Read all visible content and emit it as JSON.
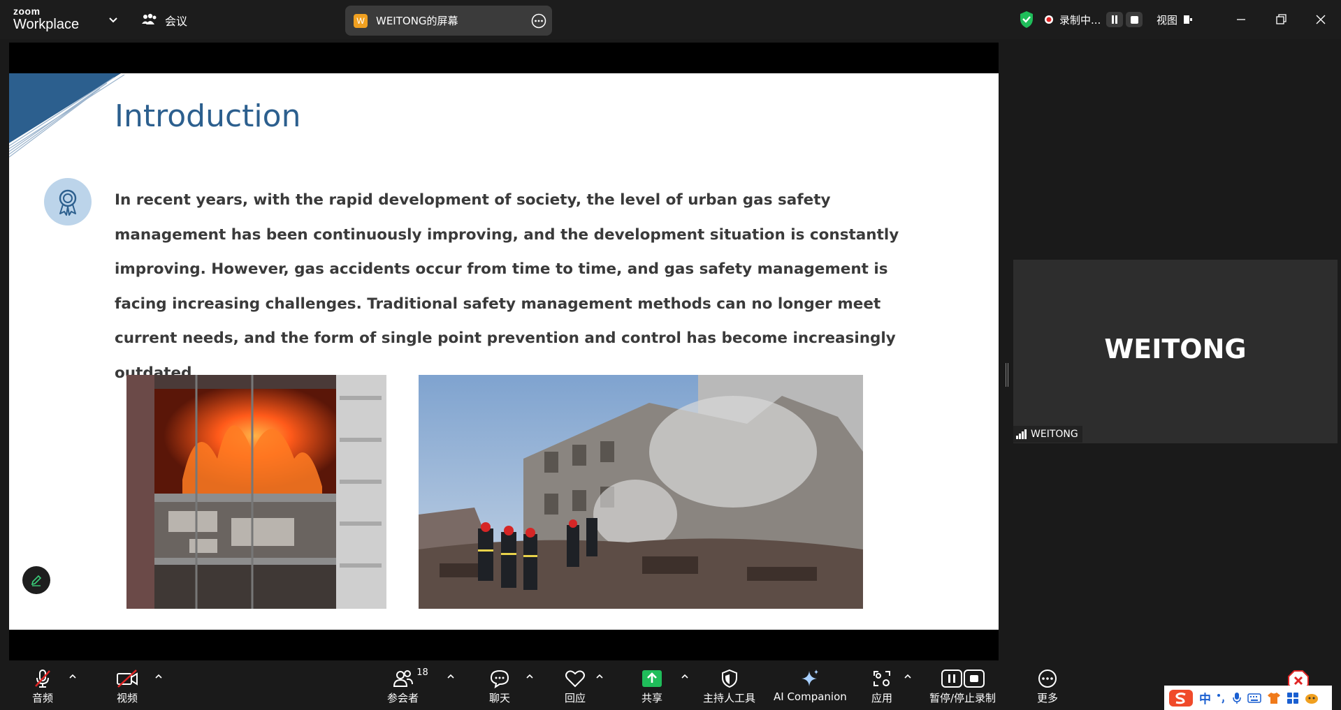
{
  "app": {
    "logo_top": "zoom",
    "logo_bottom": "Workplace"
  },
  "menu": {
    "meeting_label": "会议"
  },
  "share": {
    "initial": "W",
    "title": "WEITONG的屏幕"
  },
  "recording": {
    "status": "录制中..."
  },
  "view": {
    "label": "视图"
  },
  "slide": {
    "title": "Introduction",
    "body": "In recent years, with the rapid development of society, the level of urban gas safety management has been continuously improving, and the development situation is constantly improving. However, gas accidents occur from time to time, and gas safety management is facing increasing challenges. Traditional safety management methods can no longer meet current needs, and the form of single point prevention and control has become increasingly outdated."
  },
  "participant": {
    "tile_name": "WEITONG",
    "label": "WEITONG"
  },
  "toolbar": {
    "audio": "音频",
    "video": "视频",
    "participants": "参会者",
    "participants_count": "18",
    "chat": "聊天",
    "reactions": "回应",
    "share": "共享",
    "host_tools": "主持人工具",
    "ai_companion": "AI Companion",
    "apps": "应用",
    "recording": "暂停/停止录制",
    "more": "更多"
  },
  "ime": {
    "lang": "中"
  },
  "colors": {
    "accent_green": "#1fbd5a",
    "slide_title": "#2c5f8e",
    "record_red": "#e02424"
  }
}
